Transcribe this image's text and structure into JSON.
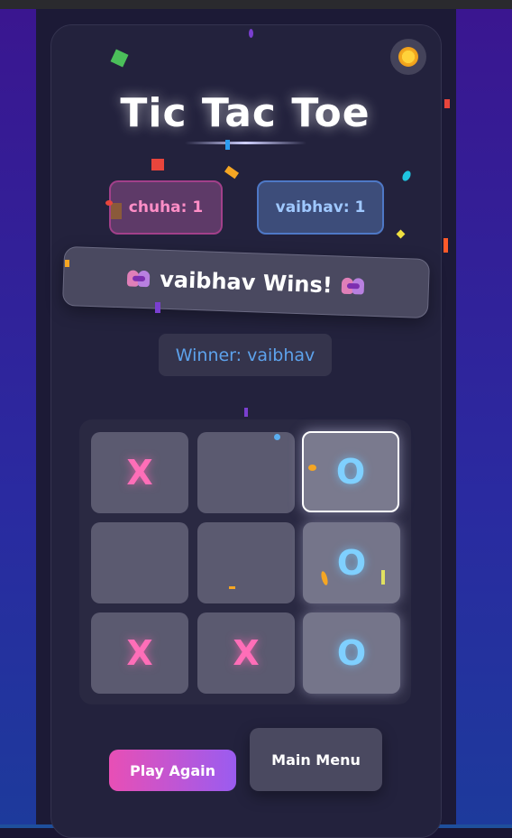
{
  "app": {
    "title": "Tic Tac Toe"
  },
  "theme_toggle": {
    "icon": "sun-icon"
  },
  "scores": {
    "player1": {
      "label": "chuha: 1",
      "color": "#ff8ec7"
    },
    "player2": {
      "label": "vaibhav: 1",
      "color": "#9fc8ff"
    }
  },
  "banner": {
    "text": "vaibhav Wins!",
    "icon": "party-emoji-icon"
  },
  "winner_label": "Winner: vaibhav",
  "board": {
    "cells": [
      "X",
      "",
      "O",
      "",
      "",
      "O",
      "X",
      "X",
      "O"
    ],
    "x_color": "#ff6eb8",
    "o_color": "#7fd0ff"
  },
  "buttons": {
    "play_again": "Play Again",
    "main_menu": "Main Menu"
  }
}
